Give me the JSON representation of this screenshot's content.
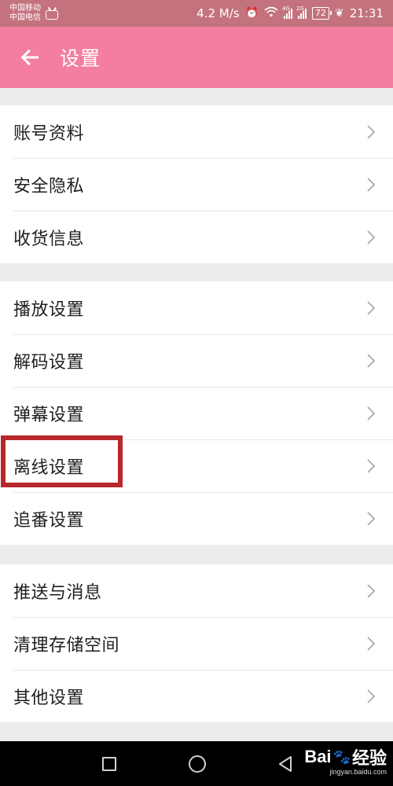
{
  "status_bar": {
    "carrier_1": "中国移动",
    "carrier_2": "中国电信",
    "speed": "4.2 M/s",
    "net_1": "4G",
    "net_2": "2G",
    "battery": "72",
    "time": "21:31"
  },
  "app_bar": {
    "title": "设置"
  },
  "groups": [
    {
      "items": [
        {
          "label": "账号资料"
        },
        {
          "label": "安全隐私"
        },
        {
          "label": "收货信息"
        }
      ]
    },
    {
      "items": [
        {
          "label": "播放设置"
        },
        {
          "label": "解码设置"
        },
        {
          "label": "弹幕设置"
        },
        {
          "label": "离线设置",
          "highlighted": true
        },
        {
          "label": "追番设置"
        }
      ]
    },
    {
      "items": [
        {
          "label": "推送与消息"
        },
        {
          "label": "清理存储空间"
        },
        {
          "label": "其他设置"
        }
      ]
    }
  ],
  "watermark": {
    "brand_a": "Bai",
    "brand_b": "经验",
    "url": "jingyan.baidu.com"
  },
  "colors": {
    "status_bar": "#c4727e",
    "app_bar": "#f37e9f",
    "highlight": "#b7272b"
  },
  "icons": [
    "tv-icon",
    "alarm-icon",
    "wifi-icon",
    "signal-icon",
    "battery-icon",
    "leaf-icon",
    "back-arrow-icon",
    "chevron-right-icon",
    "recent-apps-icon",
    "home-icon",
    "nav-back-icon",
    "paw-icon"
  ]
}
